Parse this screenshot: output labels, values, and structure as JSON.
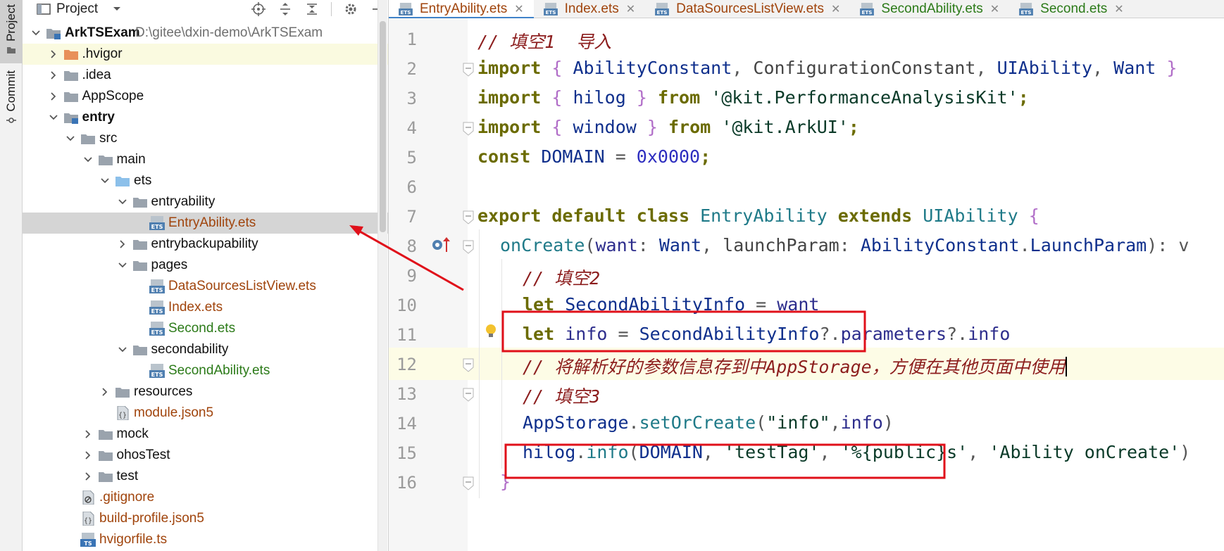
{
  "side_strip": {
    "tabs": [
      {
        "label": "Project",
        "icon": "folder-icon",
        "active": true
      },
      {
        "label": "Commit",
        "icon": "commit-icon",
        "active": false
      }
    ]
  },
  "project_panel": {
    "title": "Project",
    "tools": [
      "locate-icon",
      "expand-all-icon",
      "collapse-all-icon",
      "gear-icon",
      "minimize-icon"
    ],
    "tree": [
      {
        "label": "ArkTSExam",
        "path": "D:\\gitee\\dxin-demo\\ArkTSExam",
        "depth": 0,
        "expanded": true,
        "type": "module",
        "style": "bold"
      },
      {
        "label": ".hvigor",
        "depth": 1,
        "expanded": false,
        "type": "folder-orange",
        "style": "normal",
        "state": "hover"
      },
      {
        "label": ".idea",
        "depth": 1,
        "expanded": false,
        "type": "folder",
        "style": "normal"
      },
      {
        "label": "AppScope",
        "depth": 1,
        "expanded": false,
        "type": "folder",
        "style": "normal"
      },
      {
        "label": "entry",
        "depth": 1,
        "expanded": true,
        "type": "module",
        "style": "bold"
      },
      {
        "label": "src",
        "depth": 2,
        "expanded": true,
        "type": "folder",
        "style": "normal"
      },
      {
        "label": "main",
        "depth": 3,
        "expanded": true,
        "type": "folder",
        "style": "normal"
      },
      {
        "label": "ets",
        "depth": 4,
        "expanded": true,
        "type": "folder-blue",
        "style": "normal"
      },
      {
        "label": "entryability",
        "depth": 5,
        "expanded": true,
        "type": "folder",
        "style": "normal"
      },
      {
        "label": "EntryAbility.ets",
        "depth": 6,
        "type": "ets-file",
        "style": "brown",
        "state": "selected"
      },
      {
        "label": "entrybackupability",
        "depth": 5,
        "expanded": false,
        "type": "folder",
        "style": "normal"
      },
      {
        "label": "pages",
        "depth": 5,
        "expanded": true,
        "type": "folder",
        "style": "normal"
      },
      {
        "label": "DataSourcesListView.ets",
        "depth": 6,
        "type": "ets-file",
        "style": "brown"
      },
      {
        "label": "Index.ets",
        "depth": 6,
        "type": "ets-file",
        "style": "brown"
      },
      {
        "label": "Second.ets",
        "depth": 6,
        "type": "ets-file",
        "style": "green"
      },
      {
        "label": "secondability",
        "depth": 5,
        "expanded": true,
        "type": "folder",
        "style": "normal"
      },
      {
        "label": "SecondAbility.ets",
        "depth": 6,
        "type": "ets-file",
        "style": "green"
      },
      {
        "label": "resources",
        "depth": 4,
        "expanded": false,
        "type": "folder",
        "style": "normal"
      },
      {
        "label": "module.json5",
        "depth": 4,
        "type": "json-file",
        "style": "brown"
      },
      {
        "label": "mock",
        "depth": 3,
        "expanded": false,
        "type": "folder",
        "style": "normal"
      },
      {
        "label": "ohosTest",
        "depth": 3,
        "expanded": false,
        "type": "folder",
        "style": "normal"
      },
      {
        "label": "test",
        "depth": 3,
        "expanded": false,
        "type": "folder",
        "style": "normal"
      },
      {
        "label": ".gitignore",
        "depth": 2,
        "type": "ignore-file",
        "style": "brown"
      },
      {
        "label": "build-profile.json5",
        "depth": 2,
        "type": "json-file",
        "style": "brown"
      },
      {
        "label": "hvigorfile.ts",
        "depth": 2,
        "type": "ts-file",
        "style": "brown"
      }
    ]
  },
  "editor_tabs": [
    {
      "label": "EntryAbility.ets",
      "style": "brown",
      "active": true,
      "closable": true
    },
    {
      "label": "Index.ets",
      "style": "brown",
      "active": false,
      "closable": true
    },
    {
      "label": "DataSourcesListView.ets",
      "style": "brown",
      "active": false,
      "closable": true
    },
    {
      "label": "SecondAbility.ets",
      "style": "green",
      "active": false,
      "closable": true
    },
    {
      "label": "Second.ets",
      "style": "green",
      "active": false,
      "closable": true
    }
  ],
  "editor": {
    "lines": [
      {
        "num": "1",
        "tokens": [
          [
            "cmt",
            "// 填空1  导入"
          ]
        ]
      },
      {
        "num": "2",
        "fold": true,
        "tokens": [
          [
            "kw",
            "import"
          ],
          [
            "pn",
            " "
          ],
          [
            "br",
            "{"
          ],
          [
            "pn",
            " "
          ],
          [
            "ty",
            "AbilityConstant"
          ],
          [
            "pn",
            ", "
          ],
          [
            "gr",
            "ConfigurationConstant"
          ],
          [
            "pn",
            ", "
          ],
          [
            "ty",
            "UIAbility"
          ],
          [
            "pn",
            ", "
          ],
          [
            "ty",
            "Want"
          ],
          [
            "pn",
            " "
          ],
          [
            "br",
            "}"
          ]
        ]
      },
      {
        "num": "3",
        "tokens": [
          [
            "kw",
            "import"
          ],
          [
            "pn",
            " "
          ],
          [
            "br",
            "{"
          ],
          [
            "pn",
            " "
          ],
          [
            "ty",
            "hilog"
          ],
          [
            "pn",
            " "
          ],
          [
            "br",
            "}"
          ],
          [
            "pn",
            " "
          ],
          [
            "kw",
            "from"
          ],
          [
            "pn",
            " "
          ],
          [
            "str",
            "'@kit.PerformanceAnalysisKit'"
          ],
          [
            "kw",
            ";"
          ]
        ]
      },
      {
        "num": "4",
        "fold": true,
        "tokens": [
          [
            "kw",
            "import"
          ],
          [
            "pn",
            " "
          ],
          [
            "br",
            "{"
          ],
          [
            "pn",
            " "
          ],
          [
            "ty",
            "window"
          ],
          [
            "pn",
            " "
          ],
          [
            "br",
            "}"
          ],
          [
            "pn",
            " "
          ],
          [
            "kw",
            "from"
          ],
          [
            "pn",
            " "
          ],
          [
            "str",
            "'@kit.ArkUI'"
          ],
          [
            "kw",
            ";"
          ]
        ]
      },
      {
        "num": "5",
        "tokens": [
          [
            "kw",
            "const"
          ],
          [
            "pn",
            " "
          ],
          [
            "ty",
            "DOMAIN"
          ],
          [
            "pn",
            " = "
          ],
          [
            "num",
            "0x0000"
          ],
          [
            "kw",
            ";"
          ]
        ]
      },
      {
        "num": "6",
        "tokens": []
      },
      {
        "num": "7",
        "fold": true,
        "tokens": [
          [
            "kw",
            "export default class"
          ],
          [
            "pn",
            " "
          ],
          [
            "fn",
            "EntryAbility"
          ],
          [
            "pn",
            " "
          ],
          [
            "kw",
            "extends"
          ],
          [
            "pn",
            " "
          ],
          [
            "fn",
            "UIAbility"
          ],
          [
            "pn",
            " "
          ],
          [
            "br",
            "{"
          ]
        ]
      },
      {
        "num": "8",
        "fold": true,
        "indent": 1,
        "tokens": [
          [
            "fn",
            "onCreate"
          ],
          [
            "pn",
            "("
          ],
          [
            "prop",
            "want"
          ],
          [
            "pn",
            ": "
          ],
          [
            "ty",
            "Want"
          ],
          [
            "pn",
            ", "
          ],
          [
            "gr",
            "launchParam"
          ],
          [
            "pn",
            ": "
          ],
          [
            "ty",
            "AbilityConstant"
          ],
          [
            "pn",
            "."
          ],
          [
            "ty",
            "LaunchParam"
          ],
          [
            "pn",
            "): v"
          ]
        ]
      },
      {
        "num": "9",
        "indent": 2,
        "tokens": [
          [
            "cmt",
            "// 填空2"
          ]
        ]
      },
      {
        "num": "10",
        "indent": 2,
        "tokens": [
          [
            "kw",
            "let"
          ],
          [
            "pn",
            " "
          ],
          [
            "ty",
            "SecondAbilityInfo"
          ],
          [
            "pn",
            " = "
          ],
          [
            "prop",
            "want"
          ]
        ]
      },
      {
        "num": "11",
        "indent": 2,
        "bulb": true,
        "tokens": [
          [
            "kw",
            "let"
          ],
          [
            "pn",
            " "
          ],
          [
            "prop",
            "info"
          ],
          [
            "pn",
            " = "
          ],
          [
            "ty",
            "SecondAbilityInfo"
          ],
          [
            "pn",
            "?."
          ],
          [
            "prop",
            "parameters"
          ],
          [
            "pn",
            "?."
          ],
          [
            "prop",
            "info"
          ]
        ]
      },
      {
        "num": "12",
        "indent": 2,
        "fold": true,
        "current": true,
        "caret": true,
        "tokens": [
          [
            "cmt",
            "// 将解析好的参数信息存到中AppStorage，方便在其他页面中使用"
          ]
        ]
      },
      {
        "num": "13",
        "indent": 2,
        "fold": true,
        "tokens": [
          [
            "cmt",
            "// 填空3"
          ]
        ]
      },
      {
        "num": "14",
        "indent": 2,
        "tokens": [
          [
            "ty",
            "AppStorage"
          ],
          [
            "pn",
            "."
          ],
          [
            "fn",
            "setOrCreate"
          ],
          [
            "pn",
            "("
          ],
          [
            "str",
            "\"info\""
          ],
          [
            "pn",
            ","
          ],
          [
            "prop",
            "info"
          ],
          [
            "pn",
            ")"
          ]
        ]
      },
      {
        "num": "15",
        "indent": 2,
        "tokens": [
          [
            "ty",
            "hilog"
          ],
          [
            "pn",
            "."
          ],
          [
            "fn",
            "info"
          ],
          [
            "pn",
            "("
          ],
          [
            "ty",
            "DOMAIN"
          ],
          [
            "pn",
            ", "
          ],
          [
            "str",
            "'testTag'"
          ],
          [
            "pn",
            ", "
          ],
          [
            "str",
            "'%{public}s'"
          ],
          [
            "pn",
            ", "
          ],
          [
            "str",
            "'Ability onCreate'"
          ],
          [
            "pn",
            ")"
          ]
        ]
      },
      {
        "num": "16",
        "fold": true,
        "indent": 1,
        "tokens": [
          [
            "br",
            "}"
          ]
        ]
      }
    ]
  },
  "colors": {
    "highlight_box": "#e0101a",
    "arrow": "#e0101a",
    "tab_underline": "#4083c9"
  }
}
